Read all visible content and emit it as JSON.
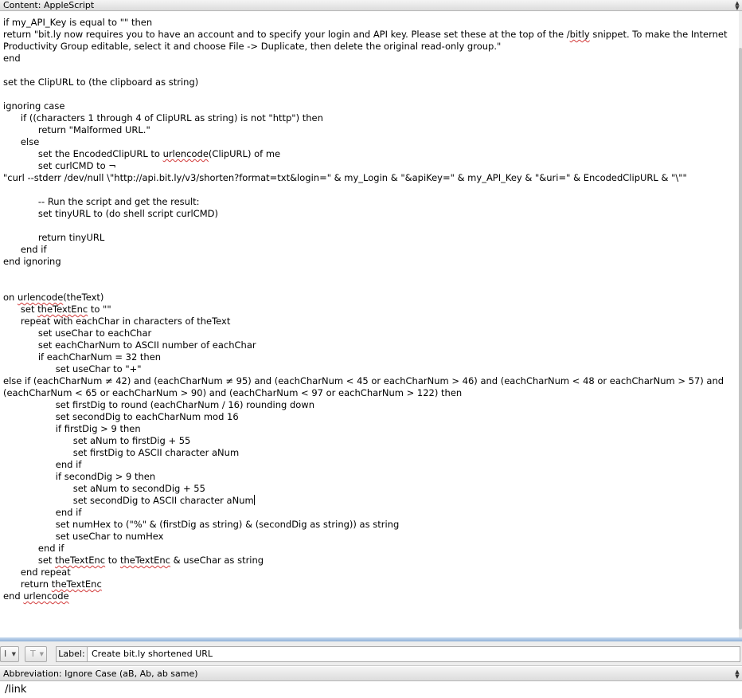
{
  "content_header": {
    "label": "Content: AppleScript"
  },
  "code_lines": [
    "if my_API_Key is equal to \"\" then",
    "return \"bit.ly now requires you to have an account and to specify your login and API key. Please set these at the top of the /bitly snippet. To make the Internet Productivity Group editable, select it and choose File -> Duplicate, then delete the original read-only group.\"",
    "end",
    "",
    "set the ClipURL to (the clipboard as string)",
    "",
    "ignoring case",
    "      if ((characters 1 through 4 of ClipURL as string) is not \"http\") then",
    "            return \"Malformed URL.\"",
    "      else",
    "            set the EncodedClipURL to urlencode(ClipURL) of me",
    "            set curlCMD to ¬",
    "                  \"curl --stderr /dev/null \\\"http://api.bit.ly/v3/shorten?format=txt&login=\" & my_Login & \"&apiKey=\" & my_API_Key & \"&uri=\" & EncodedClipURL & \"\\\"\"",
    "",
    "            -- Run the script and get the result:",
    "            set tinyURL to (do shell script curlCMD)",
    "",
    "            return tinyURL",
    "      end if",
    "end ignoring",
    "",
    "",
    "on urlencode(theText)",
    "      set theTextEnc to \"\"",
    "      repeat with eachChar in characters of theText",
    "            set useChar to eachChar",
    "            set eachCharNum to ASCII number of eachChar",
    "            if eachCharNum = 32 then",
    "                  set useChar to \"+\"",
    "            else if (eachCharNum ≠ 42) and (eachCharNum ≠ 95) and (eachCharNum < 45 or eachCharNum > 46) and (eachCharNum < 48 or eachCharNum > 57) and (eachCharNum < 65 or eachCharNum > 90) and (eachCharNum < 97 or eachCharNum > 122) then",
    "                  set firstDig to round (eachCharNum / 16) rounding down",
    "                  set secondDig to eachCharNum mod 16",
    "                  if firstDig > 9 then",
    "                        set aNum to firstDig + 55",
    "                        set firstDig to ASCII character aNum",
    "                  end if",
    "                  if secondDig > 9 then",
    "                        set aNum to secondDig + 55",
    "                        set secondDig to ASCII character aNum",
    "                  end if",
    "                  set numHex to (\"%\" & (firstDig as string) & (secondDig as string)) as string",
    "                  set useChar to numHex",
    "            end if",
    "            set theTextEnc to theTextEnc & useChar as string",
    "      end repeat",
    "      return theTextEnc",
    "end urlencode"
  ],
  "toolbar": {
    "insert_text_glyph": "I",
    "format_glyph": "T",
    "label_caption": "Label:",
    "label_value": "Create bit.ly shortened URL"
  },
  "abbreviation": {
    "header": "Abbreviation: Ignore Case (aB, Ab, ab same)",
    "value": "/link"
  }
}
